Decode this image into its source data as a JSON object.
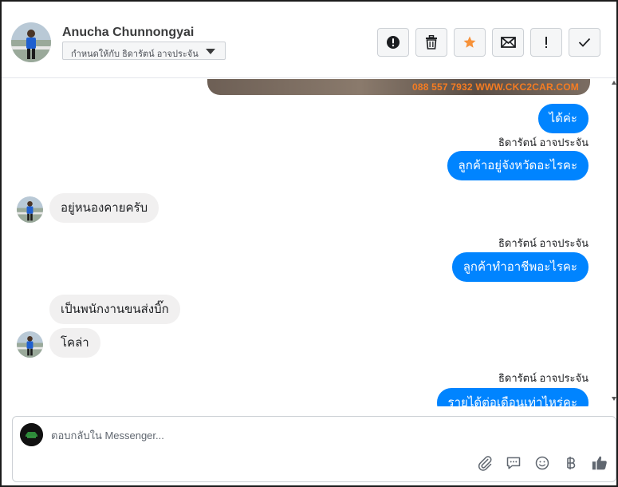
{
  "header": {
    "contact_name": "Anucha Chunnongyai",
    "assign_label": "กำหนดให้กับ ธิดารัตน์ อาจประจัน",
    "toolbar": [
      {
        "name": "spam-button",
        "icon": "exclamation-circle-icon"
      },
      {
        "name": "delete-button",
        "icon": "trash-icon"
      },
      {
        "name": "star-button",
        "icon": "star-icon"
      },
      {
        "name": "mark-unread-button",
        "icon": "envelope-icon"
      },
      {
        "name": "follow-up-button",
        "icon": "exclamation-icon"
      },
      {
        "name": "mark-done-button",
        "icon": "check-icon"
      }
    ]
  },
  "conversation": {
    "image_caption": "088 557 7932 WWW.CKC2CAR.COM",
    "messages": [
      {
        "dir": "out",
        "text": "ได้ค่ะ"
      },
      {
        "dir": "out",
        "sender": "ธิดารัตน์ อาจประจัน",
        "text": "ลูกค้าอยู่จังหวัดอะไรคะ"
      },
      {
        "dir": "in",
        "text": "อยู่หนองคายครับ"
      },
      {
        "dir": "out",
        "sender": "ธิดารัตน์ อาจประจัน",
        "text": "ลูกค้าทำอาชีพอะไรคะ"
      },
      {
        "dir": "in",
        "text": "เป็นพนักงานขนส่งบิ๊ก"
      },
      {
        "dir": "in",
        "text": "โคล่า"
      },
      {
        "dir": "out",
        "sender": "ธิดารัตน์ อาจประจัน",
        "text": "รายได้ต่อเดือนเท่าไหร่คะ"
      }
    ]
  },
  "composer": {
    "placeholder": "ตอบกลับใน Messenger...",
    "icons": [
      "paperclip-icon",
      "speech-bubble-icon",
      "emoji-icon",
      "baht-icon",
      "thumbs-up-icon"
    ]
  },
  "colors": {
    "outgoing_bubble": "#0084ff",
    "incoming_bubble": "#f1f0f0",
    "star": "#f7923a"
  }
}
